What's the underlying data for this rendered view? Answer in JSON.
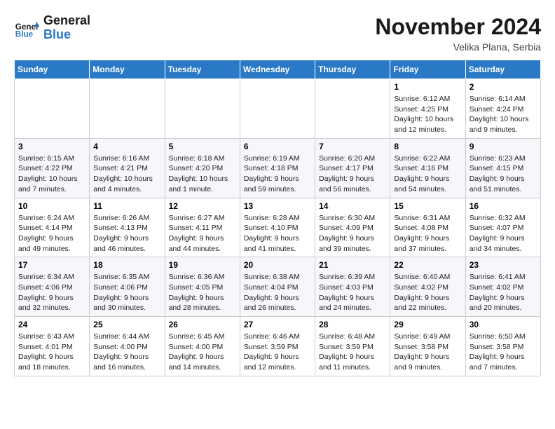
{
  "header": {
    "logo_line1": "General",
    "logo_line2": "Blue",
    "month_title": "November 2024",
    "subtitle": "Velika Plana, Serbia"
  },
  "weekdays": [
    "Sunday",
    "Monday",
    "Tuesday",
    "Wednesday",
    "Thursday",
    "Friday",
    "Saturday"
  ],
  "weeks": [
    [
      {
        "day": "",
        "info": ""
      },
      {
        "day": "",
        "info": ""
      },
      {
        "day": "",
        "info": ""
      },
      {
        "day": "",
        "info": ""
      },
      {
        "day": "",
        "info": ""
      },
      {
        "day": "1",
        "info": "Sunrise: 6:12 AM\nSunset: 4:25 PM\nDaylight: 10 hours and 12 minutes."
      },
      {
        "day": "2",
        "info": "Sunrise: 6:14 AM\nSunset: 4:24 PM\nDaylight: 10 hours and 9 minutes."
      }
    ],
    [
      {
        "day": "3",
        "info": "Sunrise: 6:15 AM\nSunset: 4:22 PM\nDaylight: 10 hours and 7 minutes."
      },
      {
        "day": "4",
        "info": "Sunrise: 6:16 AM\nSunset: 4:21 PM\nDaylight: 10 hours and 4 minutes."
      },
      {
        "day": "5",
        "info": "Sunrise: 6:18 AM\nSunset: 4:20 PM\nDaylight: 10 hours and 1 minute."
      },
      {
        "day": "6",
        "info": "Sunrise: 6:19 AM\nSunset: 4:18 PM\nDaylight: 9 hours and 59 minutes."
      },
      {
        "day": "7",
        "info": "Sunrise: 6:20 AM\nSunset: 4:17 PM\nDaylight: 9 hours and 56 minutes."
      },
      {
        "day": "8",
        "info": "Sunrise: 6:22 AM\nSunset: 4:16 PM\nDaylight: 9 hours and 54 minutes."
      },
      {
        "day": "9",
        "info": "Sunrise: 6:23 AM\nSunset: 4:15 PM\nDaylight: 9 hours and 51 minutes."
      }
    ],
    [
      {
        "day": "10",
        "info": "Sunrise: 6:24 AM\nSunset: 4:14 PM\nDaylight: 9 hours and 49 minutes."
      },
      {
        "day": "11",
        "info": "Sunrise: 6:26 AM\nSunset: 4:13 PM\nDaylight: 9 hours and 46 minutes."
      },
      {
        "day": "12",
        "info": "Sunrise: 6:27 AM\nSunset: 4:11 PM\nDaylight: 9 hours and 44 minutes."
      },
      {
        "day": "13",
        "info": "Sunrise: 6:28 AM\nSunset: 4:10 PM\nDaylight: 9 hours and 41 minutes."
      },
      {
        "day": "14",
        "info": "Sunrise: 6:30 AM\nSunset: 4:09 PM\nDaylight: 9 hours and 39 minutes."
      },
      {
        "day": "15",
        "info": "Sunrise: 6:31 AM\nSunset: 4:08 PM\nDaylight: 9 hours and 37 minutes."
      },
      {
        "day": "16",
        "info": "Sunrise: 6:32 AM\nSunset: 4:07 PM\nDaylight: 9 hours and 34 minutes."
      }
    ],
    [
      {
        "day": "17",
        "info": "Sunrise: 6:34 AM\nSunset: 4:06 PM\nDaylight: 9 hours and 32 minutes."
      },
      {
        "day": "18",
        "info": "Sunrise: 6:35 AM\nSunset: 4:06 PM\nDaylight: 9 hours and 30 minutes."
      },
      {
        "day": "19",
        "info": "Sunrise: 6:36 AM\nSunset: 4:05 PM\nDaylight: 9 hours and 28 minutes."
      },
      {
        "day": "20",
        "info": "Sunrise: 6:38 AM\nSunset: 4:04 PM\nDaylight: 9 hours and 26 minutes."
      },
      {
        "day": "21",
        "info": "Sunrise: 6:39 AM\nSunset: 4:03 PM\nDaylight: 9 hours and 24 minutes."
      },
      {
        "day": "22",
        "info": "Sunrise: 6:40 AM\nSunset: 4:02 PM\nDaylight: 9 hours and 22 minutes."
      },
      {
        "day": "23",
        "info": "Sunrise: 6:41 AM\nSunset: 4:02 PM\nDaylight: 9 hours and 20 minutes."
      }
    ],
    [
      {
        "day": "24",
        "info": "Sunrise: 6:43 AM\nSunset: 4:01 PM\nDaylight: 9 hours and 18 minutes."
      },
      {
        "day": "25",
        "info": "Sunrise: 6:44 AM\nSunset: 4:00 PM\nDaylight: 9 hours and 16 minutes."
      },
      {
        "day": "26",
        "info": "Sunrise: 6:45 AM\nSunset: 4:00 PM\nDaylight: 9 hours and 14 minutes."
      },
      {
        "day": "27",
        "info": "Sunrise: 6:46 AM\nSunset: 3:59 PM\nDaylight: 9 hours and 12 minutes."
      },
      {
        "day": "28",
        "info": "Sunrise: 6:48 AM\nSunset: 3:59 PM\nDaylight: 9 hours and 11 minutes."
      },
      {
        "day": "29",
        "info": "Sunrise: 6:49 AM\nSunset: 3:58 PM\nDaylight: 9 hours and 9 minutes."
      },
      {
        "day": "30",
        "info": "Sunrise: 6:50 AM\nSunset: 3:58 PM\nDaylight: 9 hours and 7 minutes."
      }
    ]
  ]
}
